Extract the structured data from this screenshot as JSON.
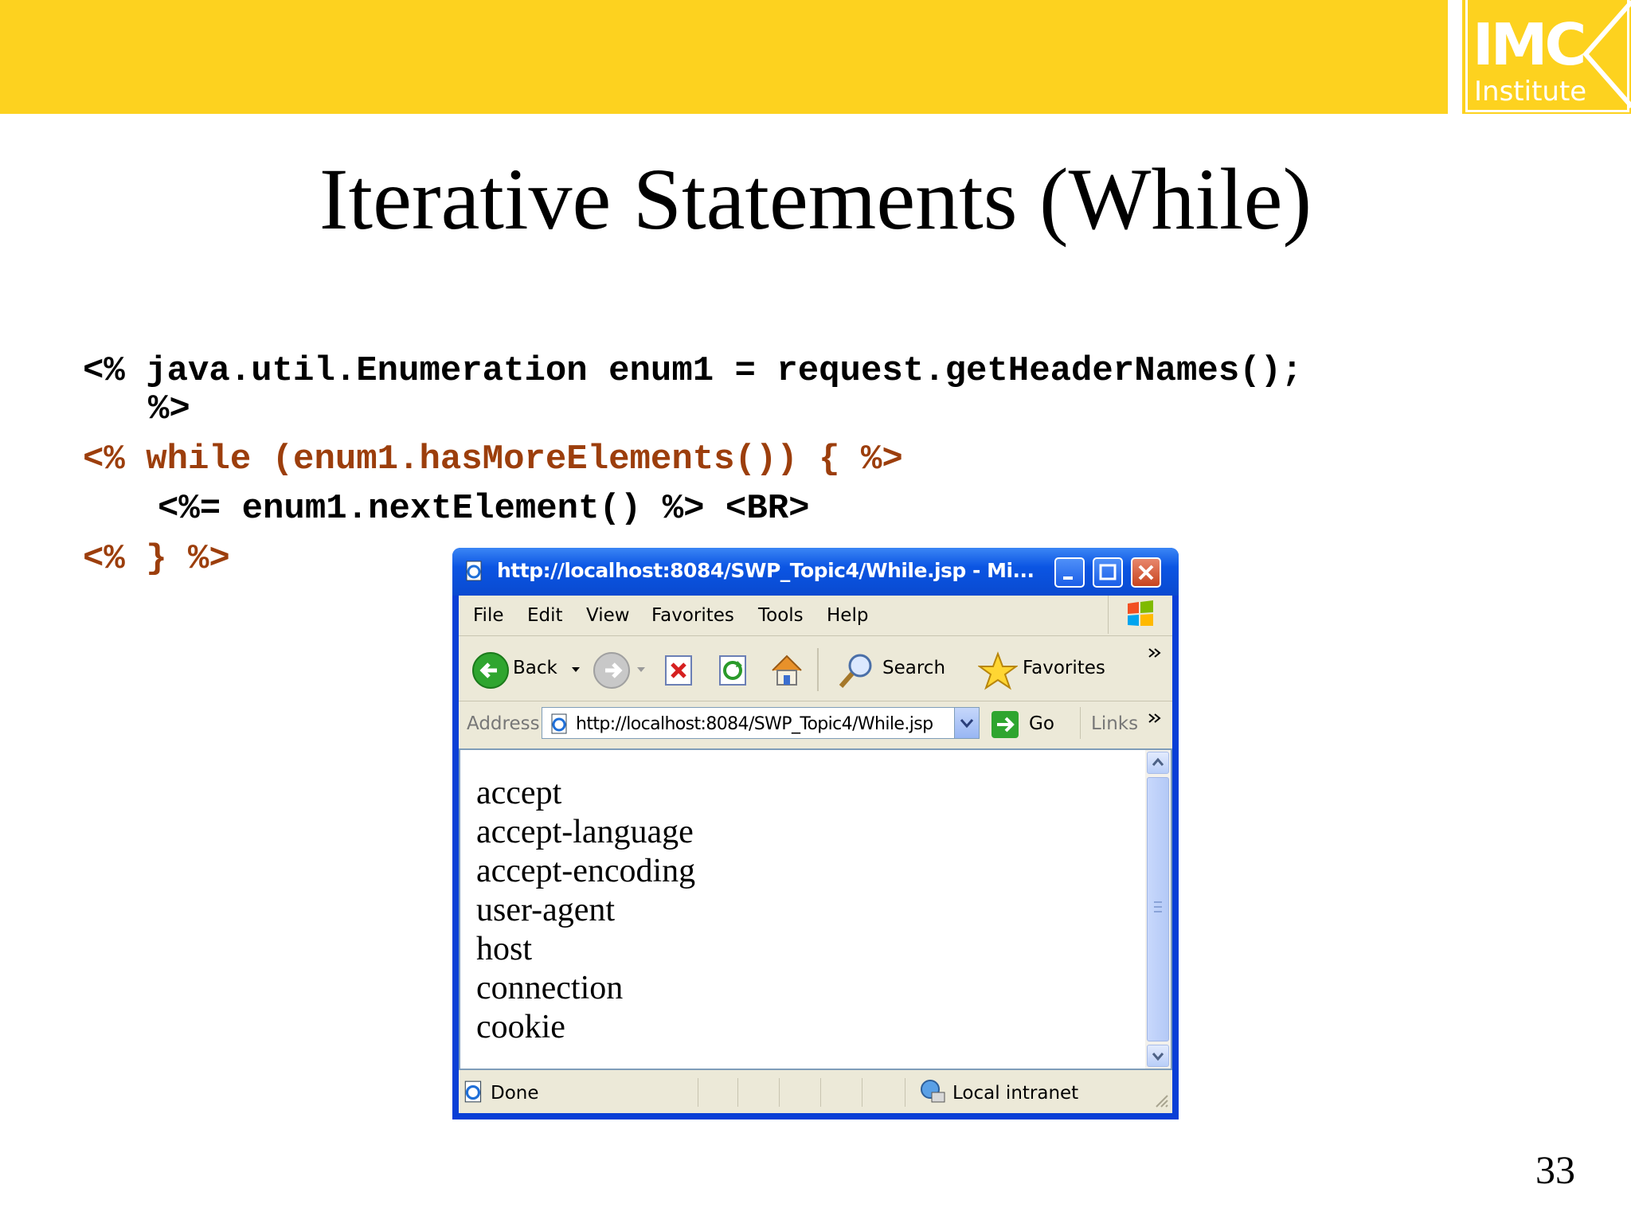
{
  "slide": {
    "title": "Iterative Statements (While)",
    "page_number": "33",
    "logo": {
      "name": "IMC",
      "sub": "Institute"
    }
  },
  "code": {
    "line1": "<% java.util.Enumeration enum1 = request.getHeaderNames();",
    "line1b": "%>",
    "line2": "<% while (enum1.hasMoreElements()) { %>",
    "line3": "<%= enum1.nextElement() %> <BR>",
    "line4": "<% } %>"
  },
  "colors": {
    "accent": "#fdd21f",
    "code_highlight": "#9c3e0c",
    "window_frame": "#0a3fd6"
  },
  "browser": {
    "title": "http://localhost:8084/SWP_Topic4/While.jsp - Mi...",
    "menu": [
      "File",
      "Edit",
      "View",
      "Favorites",
      "Tools",
      "Help"
    ],
    "toolbar": {
      "back": "Back",
      "search": "Search",
      "favorites": "Favorites"
    },
    "address": {
      "label": "Address",
      "value": "http://localhost:8084/SWP_Topic4/While.jsp",
      "go": "Go",
      "links": "Links"
    },
    "content_items": [
      "accept",
      "accept-language",
      "accept-encoding",
      "user-agent",
      "host",
      "connection",
      "cookie"
    ],
    "status": {
      "left": "Done",
      "zone": "Local intranet"
    }
  }
}
